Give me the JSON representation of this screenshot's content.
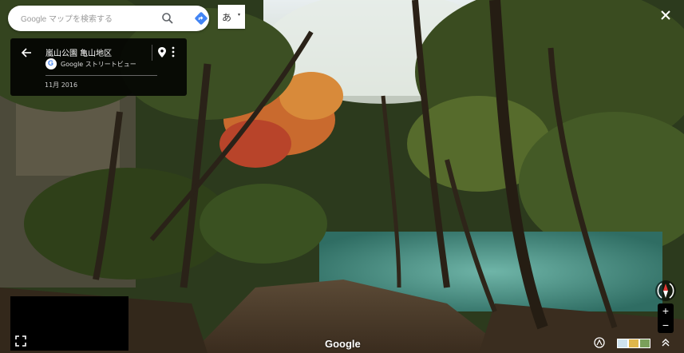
{
  "search": {
    "placeholder": "Google マップを検索する"
  },
  "ime": {
    "label": "あ",
    "caret": "▾"
  },
  "panel": {
    "place_name": "嵐山公園 亀山地区",
    "source": "Google ストリートビュー",
    "date": "11月 2016"
  },
  "footer": {
    "brand": "Google"
  },
  "zoom": {
    "in": "+",
    "out": "−"
  },
  "icons": {
    "search": "search-icon",
    "directions": "directions-icon",
    "close": "close-icon",
    "back": "back-arrow-icon",
    "pin": "location-pin-icon",
    "more": "more-vert-icon",
    "fullscreen": "fullscreen-icon",
    "compass": "compass-icon",
    "photo": "photo-icon",
    "expand": "expand-icon"
  },
  "colors": {
    "accent": "#4285f4",
    "panel": "#000000",
    "compass_red": "#e53935"
  }
}
